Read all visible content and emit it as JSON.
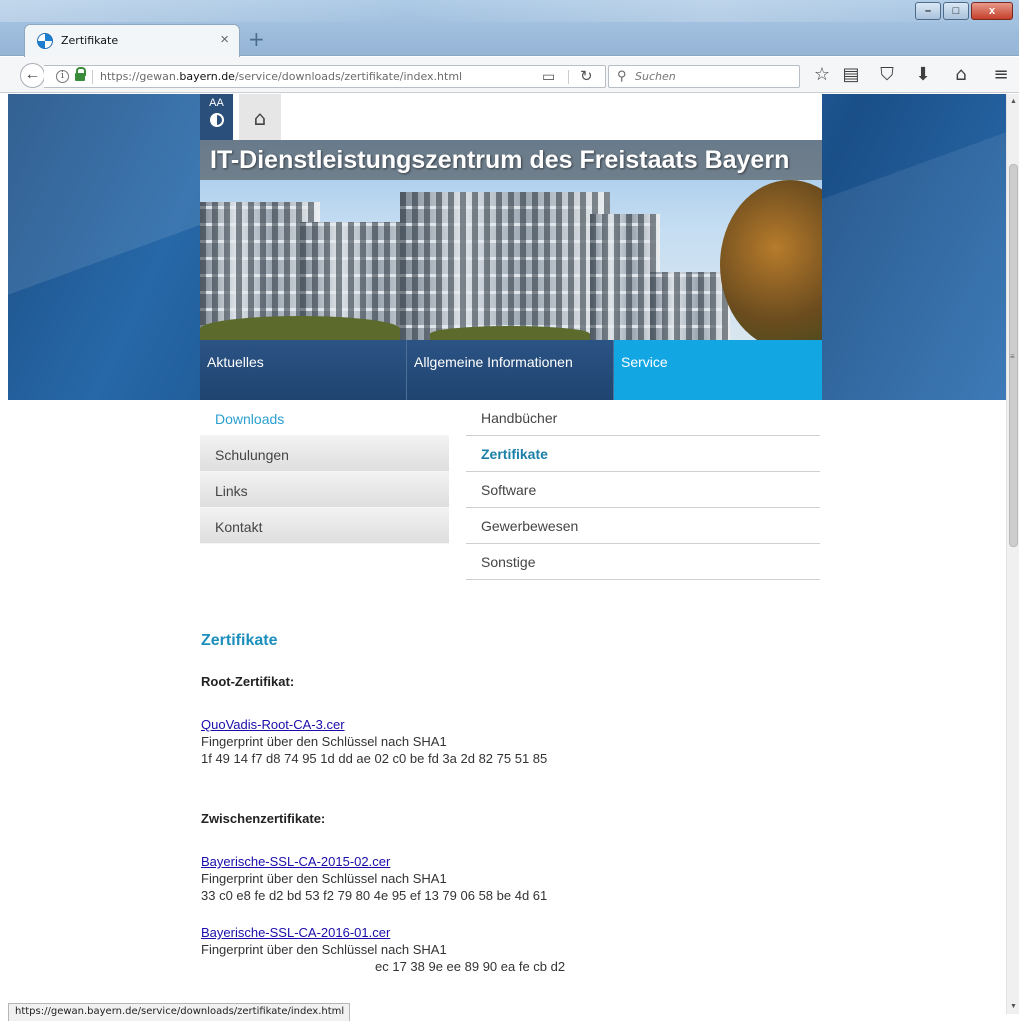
{
  "window": {
    "tab_title": "Zertifikate",
    "tab_close": "×",
    "new_tab": "+",
    "controls": {
      "minimize": "–",
      "maximize": "□",
      "close": "x"
    }
  },
  "navbar": {
    "back": "←",
    "info": "i",
    "url_prefix": "https://gewan.",
    "url_domain": "bayern.de",
    "url_path": "/service/downloads/zertifikate/index.html",
    "reader": "▭",
    "reload": "↻",
    "search_icon": "⚲",
    "search_placeholder": "Suchen",
    "icons": {
      "bookmark": "☆",
      "library": "▤",
      "pocket": "⛉",
      "download": "⬇",
      "home": "⌂",
      "menu": "≡"
    }
  },
  "site": {
    "tools": {
      "font_size": "AA",
      "home_icon": "⌂"
    },
    "banner_title": "IT-Dienstleistungszentrum des Freistaats Bayern",
    "mainnav": [
      "Aktuelles",
      "Allgemeine Informationen",
      "Service"
    ],
    "subnav_left": [
      "Downloads",
      "Schulungen",
      "Links",
      "Kontakt"
    ],
    "subnav_right": [
      "Handbücher",
      "Zertifikate",
      "Software",
      "Gewerbewesen",
      "Sonstige"
    ],
    "active": {
      "mainnav": "Service",
      "subnav_left": "Downloads",
      "subnav_right": "Zertifikate"
    }
  },
  "content": {
    "heading": "Zertifikate",
    "root_label": "Root-Zertifikat:",
    "intermediate_label": "Zwischenzertifikate:",
    "fingerprint_label": "Fingerprint über den Schlüssel nach SHA1",
    "root_cert": {
      "link": "QuoVadis-Root-CA-3.cer",
      "fingerprint": "1f 49 14 f7 d8 74 95 1d dd ae 02 c0 be fd 3a 2d 82 75 51 85"
    },
    "intermediate_certs": [
      {
        "link": "Bayerische-SSL-CA-2015-02.cer",
        "fingerprint": "33 c0 e8 fe d2 bd 53 f2 79 80 4e 95 ef 13 79 06 58 be 4d 61"
      },
      {
        "link": "Bayerische-SSL-CA-2016-01.cer",
        "fingerprint": "ec 17 38 9e ee 89 90 ea fe cb d2"
      }
    ]
  },
  "status_bar": "https://gewan.bayern.de/service/downloads/zertifikate/index.html",
  "colors": {
    "nav_dark": "#1f4470",
    "nav_active": "#12a6e3",
    "heading_teal": "#1c8fbd",
    "link": "#1a0dab"
  }
}
